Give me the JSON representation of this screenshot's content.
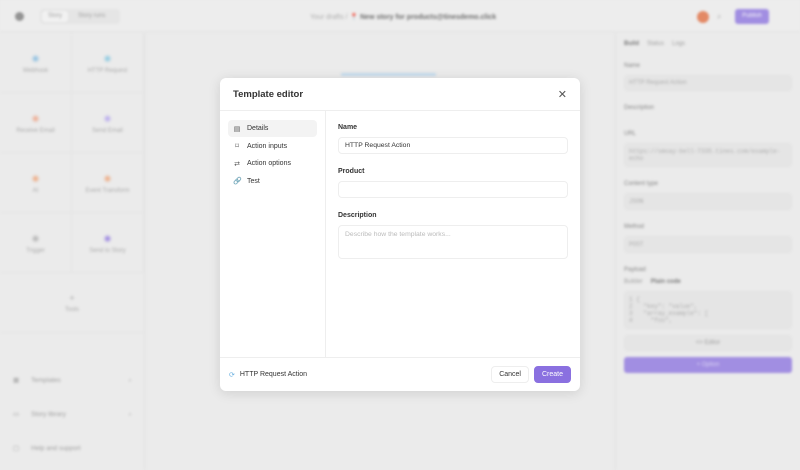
{
  "topbar": {
    "tabs": [
      "Story",
      "Story runs"
    ],
    "breadcrumb_prefix": "Your drafts /",
    "story_title": "New story for products@tinesdemo.click",
    "publish_label": "Publish"
  },
  "sidebar": {
    "tiles": [
      {
        "label": "Webhook",
        "icon": "webhook-icon",
        "color": "#7bb8e0"
      },
      {
        "label": "HTTP Request",
        "icon": "http-icon",
        "color": "#7bc4e0"
      },
      {
        "label": "Receive Email",
        "icon": "mail-icon",
        "color": "#f0a080"
      },
      {
        "label": "Send Email",
        "icon": "send-icon",
        "color": "#b0a0f0"
      },
      {
        "label": "AI",
        "icon": "ai-icon",
        "color": "#f0a070"
      },
      {
        "label": "Event Transform",
        "icon": "transform-icon",
        "color": "#f0a070"
      },
      {
        "label": "Trigger",
        "icon": "trigger-icon",
        "color": "#aaaaaa"
      },
      {
        "label": "Send to Story",
        "icon": "story-icon",
        "color": "#8a70e0"
      }
    ],
    "tools_label": "Tools",
    "bottom_items": [
      "Templates",
      "Story library",
      "Help and support"
    ]
  },
  "right_panel": {
    "tabs": [
      "Build",
      "Status",
      "Logs"
    ],
    "name_label": "Name",
    "name_value": "HTTP Request Action",
    "description_label": "Description",
    "url_label": "URL",
    "url_value": "https://smoay-bell-7335.tines.com/example-echo",
    "content_type_label": "Content type",
    "content_type_value": "JSON",
    "method_label": "Method",
    "method_value": "POST",
    "payload_label": "Payload",
    "payload_tabs": [
      "Builder",
      "Plain code"
    ],
    "code_lines": [
      "1 {",
      "2   \"key\": \"value\",",
      "3   \"array_example\": [",
      "4     \"foo\","
    ],
    "editor_label": "<> Editor",
    "option_label": "+ Option"
  },
  "modal": {
    "title": "Template editor",
    "nav": [
      {
        "label": "Details",
        "icon": "details-icon",
        "glyph": "▤"
      },
      {
        "label": "Action inputs",
        "icon": "inputs-icon",
        "glyph": "⌑"
      },
      {
        "label": "Action options",
        "icon": "options-icon",
        "glyph": "⇄"
      },
      {
        "label": "Test",
        "icon": "link-icon",
        "glyph": "🔗"
      }
    ],
    "name_label": "Name",
    "name_value": "HTTP Request Action",
    "product_label": "Product",
    "product_value": "",
    "description_label": "Description",
    "description_placeholder": "Describe how the template works...",
    "footer_action": "HTTP Request Action",
    "cancel_label": "Cancel",
    "create_label": "Create"
  },
  "colors": {
    "accent": "#8a70e0"
  }
}
